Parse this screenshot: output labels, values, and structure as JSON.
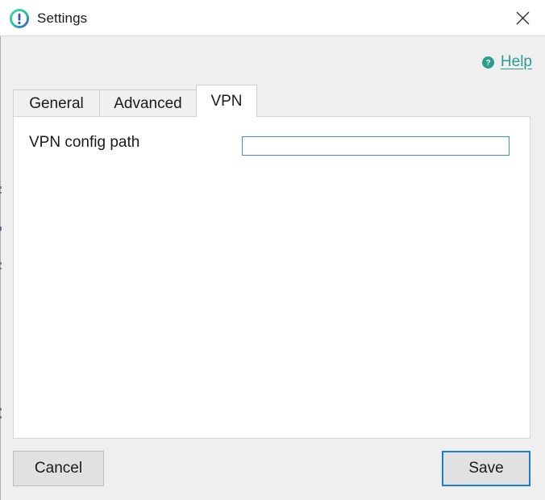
{
  "window": {
    "title": "Settings",
    "app_icon": "exclamation-circle-icon",
    "close_icon": "close-icon"
  },
  "help": {
    "icon": "question-circle-icon",
    "label": "Help"
  },
  "tabs": [
    {
      "label": "General",
      "active": false
    },
    {
      "label": "Advanced",
      "active": false
    },
    {
      "label": "VPN",
      "active": true
    }
  ],
  "form": {
    "fields": [
      {
        "label": "VPN config path",
        "value": "",
        "placeholder": ""
      }
    ]
  },
  "footer": {
    "cancel_label": "Cancel",
    "save_label": "Save"
  },
  "colors": {
    "accent_teal": "#2b9e8d",
    "focus_blue": "#1a7ed0",
    "input_border": "#3f8fd0",
    "body_bg": "#efefef",
    "panel_bg": "#ffffff"
  }
}
